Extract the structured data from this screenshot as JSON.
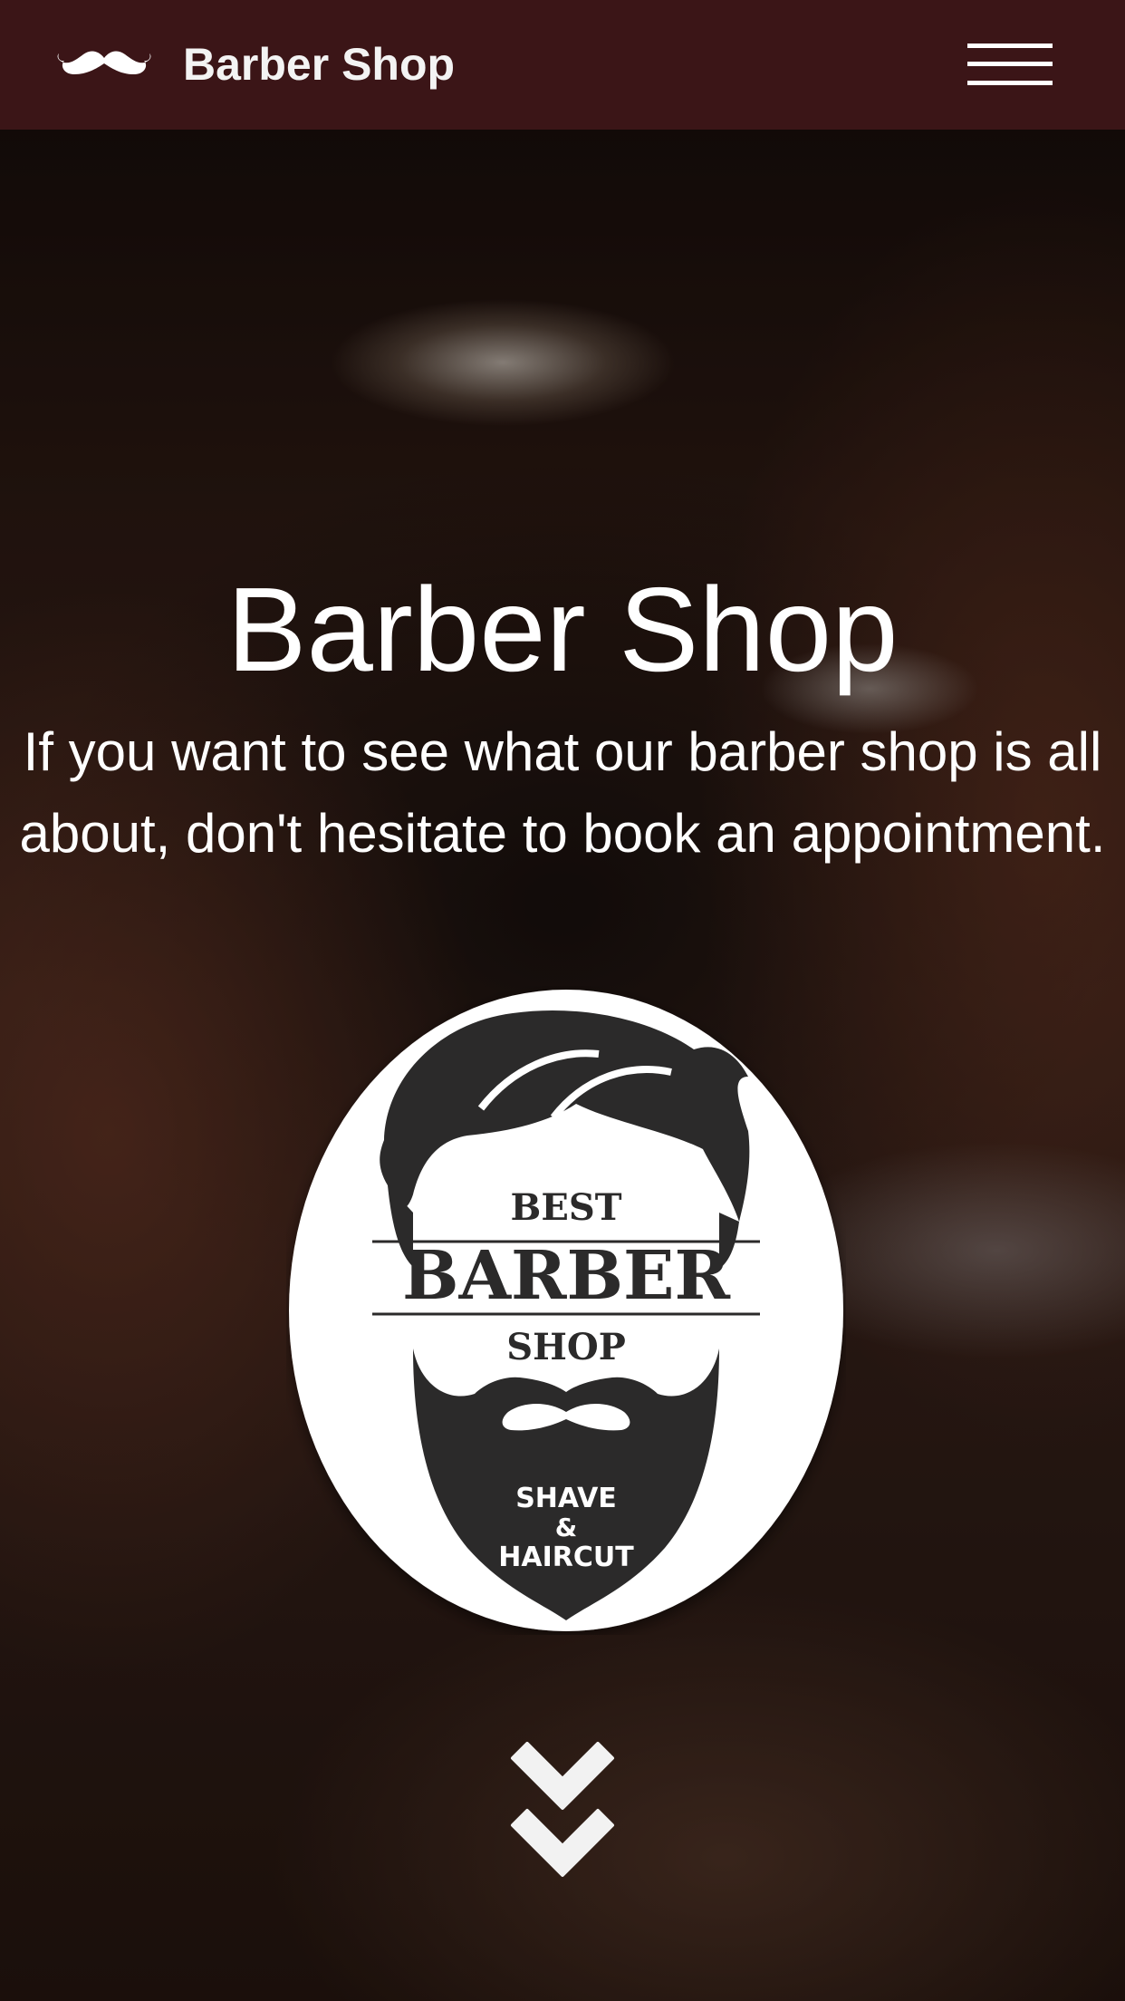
{
  "header": {
    "brand": "Barber Shop",
    "logo_icon": "mustache-icon",
    "menu_icon": "hamburger-menu-icon",
    "background_color": "#3b1517"
  },
  "hero": {
    "title": "Barber Shop",
    "subtitle": "If you want to see what our barber shop is all about, don't hesitate to book an appointment.",
    "badge": {
      "line1": "BEST",
      "line2": "BARBER",
      "line3": "SHOP",
      "tagline1": "SHAVE",
      "tagline2": "&",
      "tagline3": "HAIRCUT"
    },
    "scroll_icon": "double-chevron-down-icon"
  }
}
